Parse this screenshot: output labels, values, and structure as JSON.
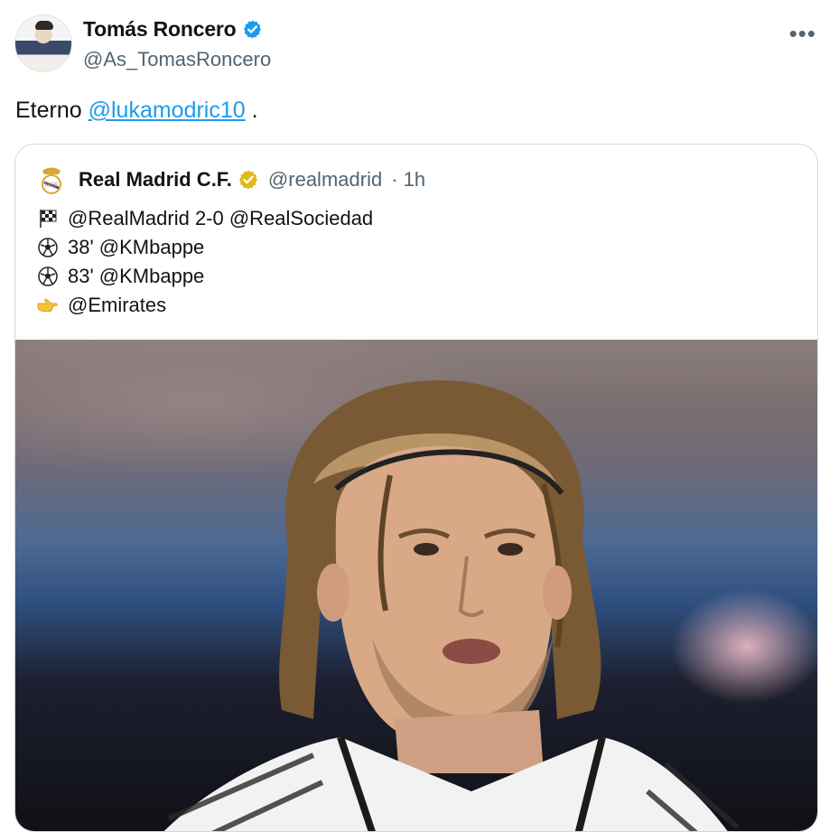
{
  "tweet": {
    "author_name": "Tomás Roncero",
    "author_handle": "@As_TomasRoncero",
    "text_prefix": "Eterno ",
    "mention": "@lukamodric10",
    "text_suffix": " ."
  },
  "quote": {
    "author_name": "Real Madrid C.F.",
    "author_handle": "@realmadrid",
    "time": "· 1h",
    "lines": [
      {
        "icon": "checkered-flag-icon",
        "text": "@RealMadrid 2-0 @RealSociedad"
      },
      {
        "icon": "soccer-ball-icon",
        "text": "38' @KMbappe"
      },
      {
        "icon": "soccer-ball-icon",
        "text": "83' @KMbappe"
      },
      {
        "icon": "pointing-hand-icon",
        "text": "@Emirates"
      }
    ]
  },
  "colors": {
    "verified_blue": "#1d9bf0",
    "verified_gold": "#e2b719",
    "link": "#1d9bf0",
    "muted": "#536471"
  }
}
